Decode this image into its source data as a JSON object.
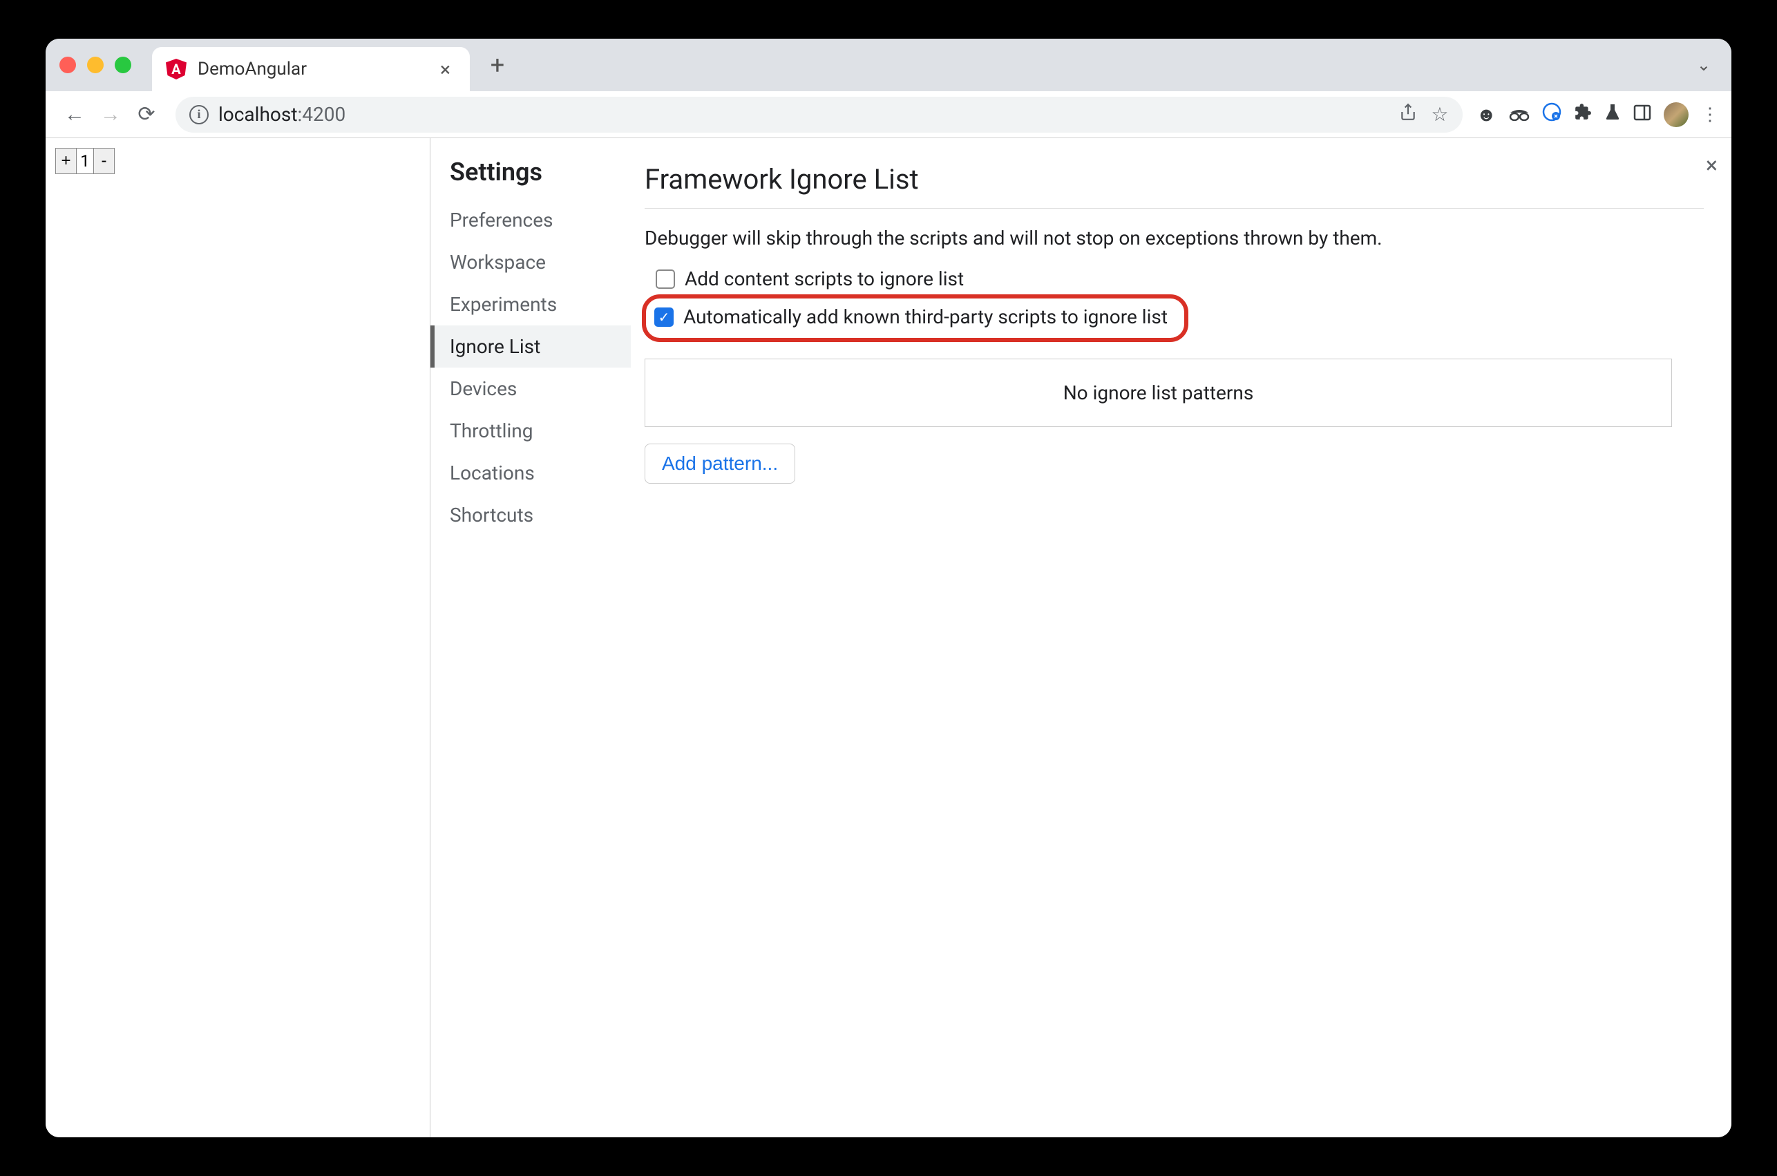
{
  "tab": {
    "title": "DemoAngular"
  },
  "url": {
    "host": "localhost",
    "port": ":4200"
  },
  "counter": {
    "plus": "+",
    "value": "1",
    "minus": "-"
  },
  "settings": {
    "heading": "Settings",
    "items": [
      {
        "label": "Preferences"
      },
      {
        "label": "Workspace"
      },
      {
        "label": "Experiments"
      },
      {
        "label": "Ignore List"
      },
      {
        "label": "Devices"
      },
      {
        "label": "Throttling"
      },
      {
        "label": "Locations"
      },
      {
        "label": "Shortcuts"
      }
    ],
    "activeIndex": 3
  },
  "main": {
    "title": "Framework Ignore List",
    "description": "Debugger will skip through the scripts and will not stop on exceptions thrown by them.",
    "checkbox1": {
      "label": "Add content scripts to ignore list",
      "checked": false
    },
    "checkbox2": {
      "label": "Automatically add known third-party scripts to ignore list",
      "checked": true
    },
    "patternsEmpty": "No ignore list patterns",
    "addPattern": "Add pattern..."
  }
}
